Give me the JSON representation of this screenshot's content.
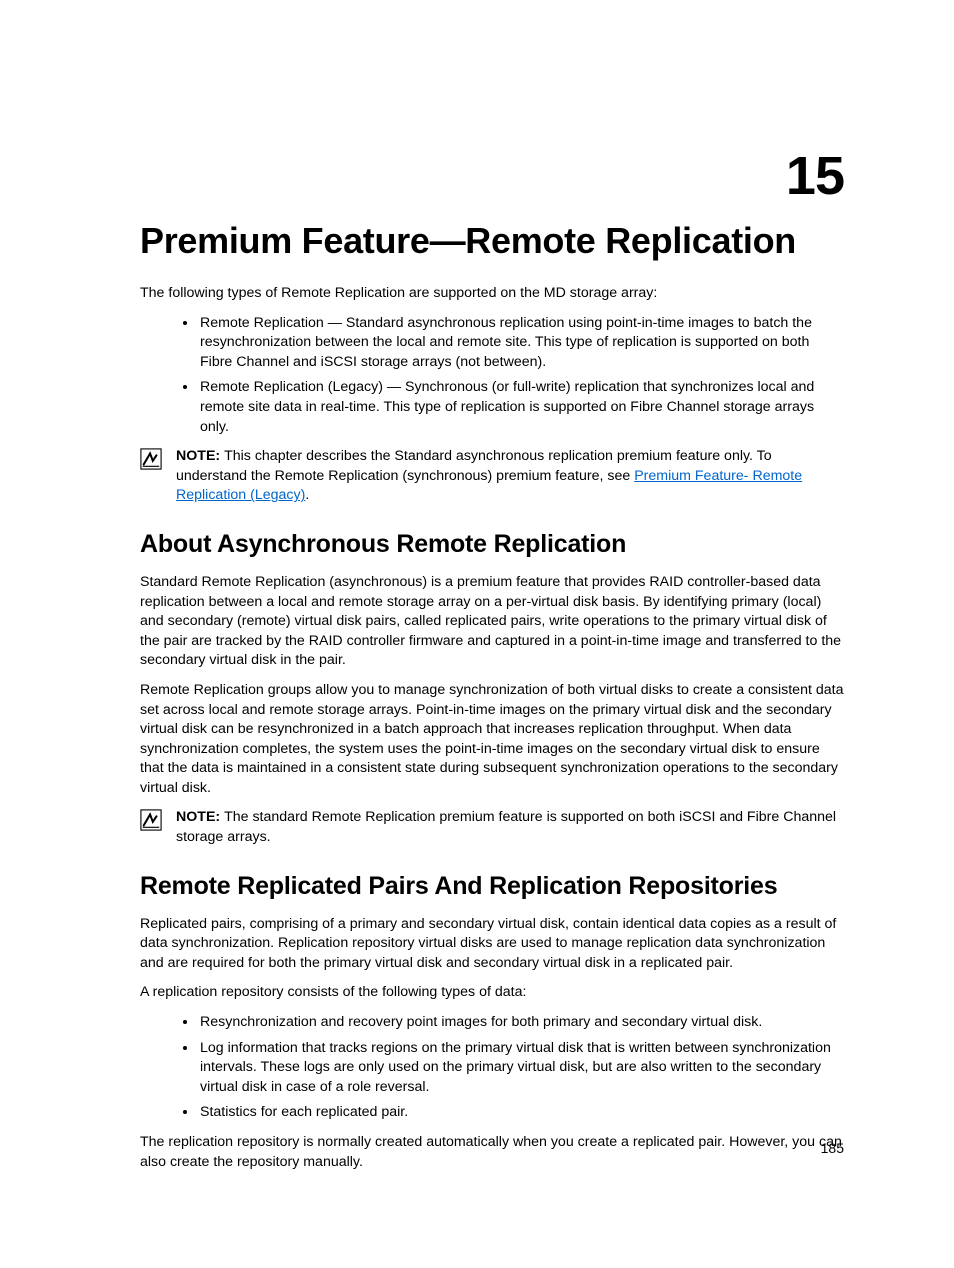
{
  "chapter_number": "15",
  "title": "Premium Feature—Remote Replication",
  "intro": "The following types of Remote Replication are supported on the MD storage array:",
  "types": [
    "Remote Replication — Standard asynchronous replication using point-in-time images to batch the resynchronization between the local and remote site. This type of replication is supported on both Fibre Channel and iSCSI storage arrays (not between).",
    "Remote Replication (Legacy) — Synchronous (or full-write) replication that synchronizes local and remote site data in real-time. This type of replication is supported on Fibre Channel storage arrays only."
  ],
  "note1_label": "NOTE: ",
  "note1_text_a": "This chapter describes the Standard asynchronous replication premium feature only. To understand the Remote Replication (synchronous) premium feature, see ",
  "note1_link": "Premium Feature- Remote Replication (Legacy)",
  "note1_text_b": ".",
  "sec1_heading": "About Asynchronous Remote Replication",
  "sec1_p1": "Standard Remote Replication (asynchronous) is a premium feature that provides RAID controller-based data replication between a local and remote storage array on a per-virtual disk basis. By identifying primary (local) and secondary (remote) virtual disk pairs, called replicated pairs, write operations to the primary virtual disk of the pair are tracked by the RAID controller firmware and captured in a point-in-time image and transferred to the secondary virtual disk in the pair.",
  "sec1_p2": "Remote Replication groups allow you to manage synchronization of both virtual disks to create a consistent data set across local and remote storage arrays. Point-in-time images on the primary virtual disk and the secondary virtual disk can be resynchronized in a batch approach that increases replication throughput. When data synchronization completes, the system uses the point-in-time images on the secondary virtual disk to ensure that the data is maintained in a consistent state during subsequent synchronization operations to the secondary virtual disk.",
  "note2_label": "NOTE: ",
  "note2_text": "The standard Remote Replication premium feature is supported on both iSCSI and Fibre Channel storage arrays.",
  "sec2_heading": "Remote Replicated Pairs And Replication Repositories",
  "sec2_p1": "Replicated pairs, comprising of a primary and secondary virtual disk, contain identical data copies as a result of data synchronization. Replication repository virtual disks are used to manage replication data synchronization and are required for both the primary virtual disk and secondary virtual disk in a replicated pair.",
  "sec2_p2": "A replication repository consists of the following types of data:",
  "sec2_bullets": [
    "Resynchronization and recovery point images for both primary and secondary virtual disk.",
    "Log information that tracks regions on the primary virtual disk that is written between synchronization intervals. These logs are only used on the primary virtual disk, but are also written to the secondary virtual disk in case of a role reversal.",
    "Statistics for each replicated pair."
  ],
  "sec2_p3": "The replication repository is normally created automatically when you create a replicated pair. However, you can also create the repository manually.",
  "page_number": "185"
}
